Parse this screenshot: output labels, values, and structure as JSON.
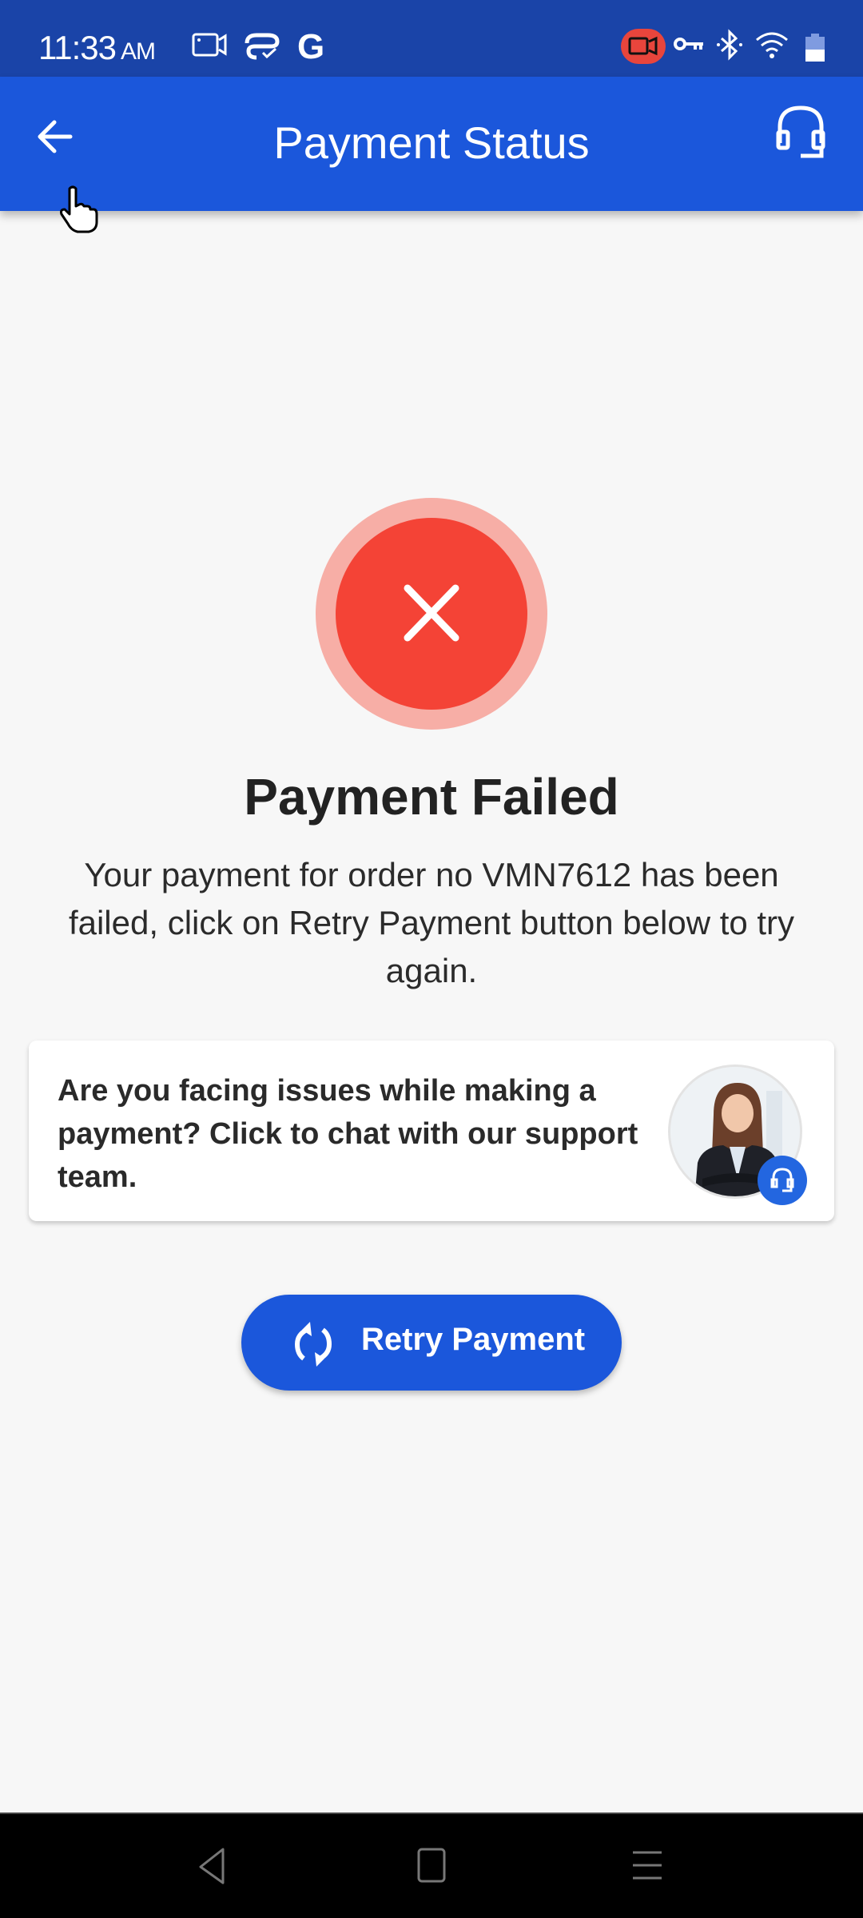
{
  "status_bar": {
    "time": "11:33",
    "ampm": "AM",
    "left_icons": [
      "screen-record-icon",
      "cloud-check-icon",
      "google-icon"
    ],
    "right_icons": [
      "recording-indicator-icon",
      "vpn-key-icon",
      "bluetooth-icon",
      "wifi-icon",
      "battery-icon"
    ]
  },
  "app_bar": {
    "title": "Payment Status",
    "back_icon": "arrow-left-icon",
    "support_icon": "headset-icon"
  },
  "status": {
    "icon": "close-icon",
    "title": "Payment Failed",
    "message": "Your payment for order no VMN7612 has been failed, click on Retry Payment button below to try again.",
    "order_no": "VMN7612",
    "colors": {
      "error": "#f44336",
      "error_ring": "#f7aea6"
    }
  },
  "support_card": {
    "text": "Are you facing issues while making a payment? Click to chat with our support team.",
    "avatar": "support-agent-avatar",
    "badge_icon": "headset-icon"
  },
  "retry_button": {
    "label": "Retry Payment",
    "icon": "refresh-icon",
    "color": "#1b57db"
  },
  "nav_bar": {
    "buttons": [
      "back",
      "home",
      "recents"
    ]
  }
}
